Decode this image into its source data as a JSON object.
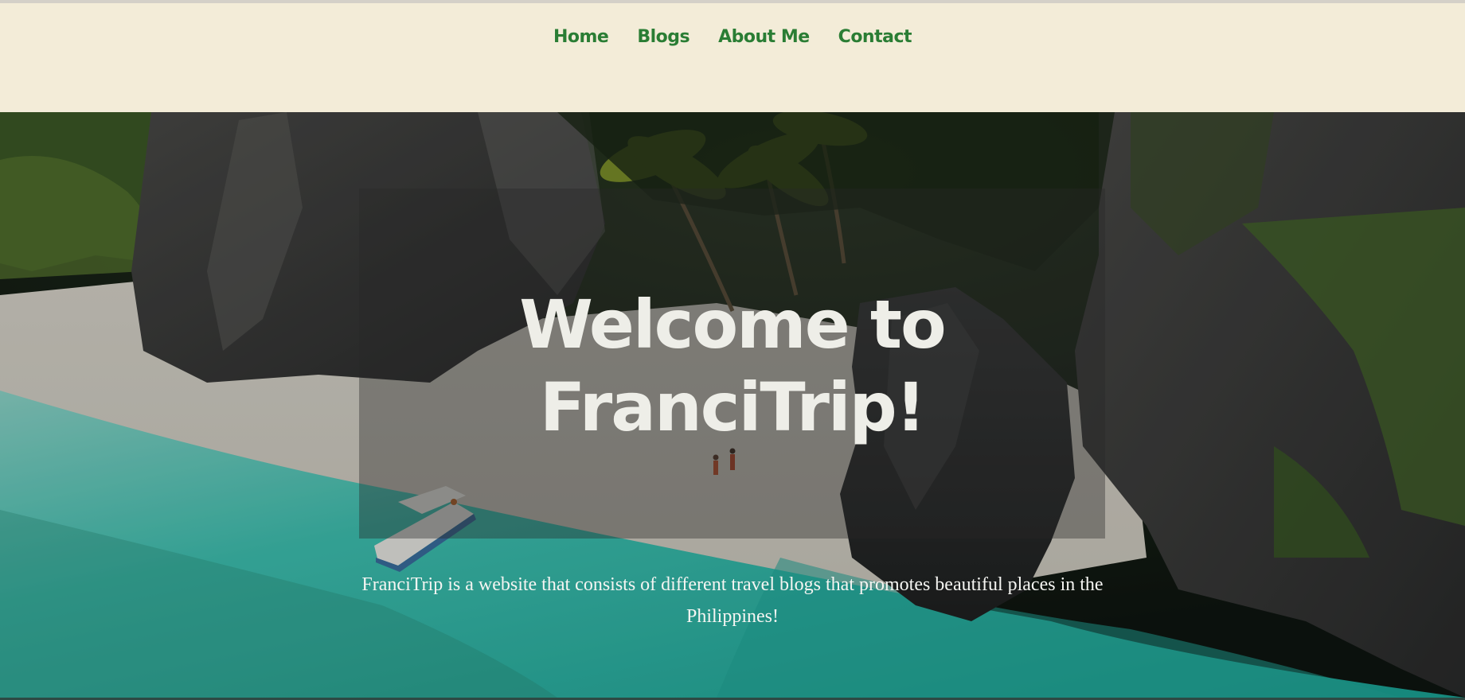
{
  "nav": {
    "items": [
      {
        "label": "Home"
      },
      {
        "label": "Blogs"
      },
      {
        "label": "About Me"
      },
      {
        "label": "Contact"
      }
    ],
    "link_color": "#2a7d34"
  },
  "hero": {
    "title": "Welcome to FranciTrip!",
    "description": "FranciTrip is a website that consists of different travel blogs that promotes beautiful places in the Philippines!",
    "background_image": "tropical-beach-cliffs-photo"
  },
  "colors": {
    "header_background": "#f3ecd8",
    "title_text": "#eeeee8"
  }
}
